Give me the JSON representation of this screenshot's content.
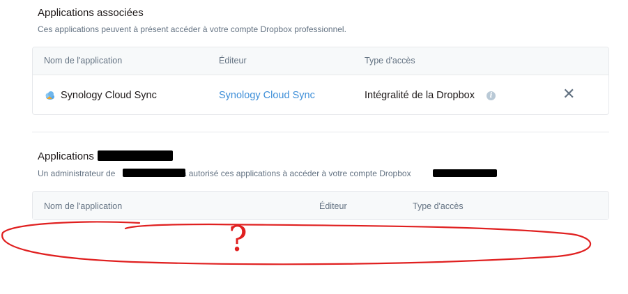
{
  "associated": {
    "title": "Applications associées",
    "description": "Ces applications peuvent à présent accéder à votre compte Dropbox professionnel.",
    "headers": {
      "app_name": "Nom de l'application",
      "publisher": "Éditeur",
      "access_type": "Type d'accès"
    },
    "rows": [
      {
        "app_name": "Synology Cloud Sync",
        "publisher": "Synology Cloud Sync",
        "access_type": "Intégralité de la Dropbox"
      }
    ]
  },
  "team": {
    "title_prefix": "Applications ",
    "description_prefix": "Un administrateur de ",
    "description_middle": "a autorisé ces applications à accéder à votre compte Dropbox",
    "headers": {
      "app_name": "Nom de l'application",
      "publisher": "Éditeur",
      "access_type": "Type d'accès"
    }
  },
  "annotation": {
    "symbol": "?",
    "color": "#e02020"
  },
  "colors": {
    "link": "#3d8ed8",
    "muted": "#637282",
    "border": "#e6e8eb"
  }
}
